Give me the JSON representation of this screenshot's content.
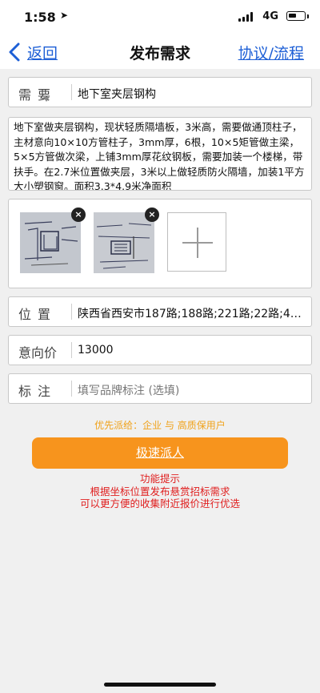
{
  "status": {
    "time": "1:58",
    "network": "4G"
  },
  "nav": {
    "back_label": "返回",
    "title": "发布需求",
    "right_label": "协议/流程"
  },
  "form": {
    "need_label": "需要",
    "need_value": "地下室夹层钢构",
    "description": "地下室做夹层钢构，现状轻质隔墙板，3米高，需要做通顶柱子，主材意向10×10方管柱子，3mm厚，6根，10×5矩管做主梁，5×5方管做次梁，上铺3mm厚花纹钢板，需要加装一个楼梯，带扶手。在2.7米位置做夹层，3米以上做轻质防火隔墙，加装1平方大小塑钢窗。面积3.3*4.9米净面积",
    "photos": [
      {
        "delete": "×"
      },
      {
        "delete": "×"
      }
    ],
    "location_label": "位置",
    "location_value": "陕西省西安市187路;188路;221路;22路;40...",
    "price_label": "意向价",
    "price_value": "13000",
    "note_label": "标注",
    "note_placeholder": "填写品牌标注 (选填)"
  },
  "priority_text": "优先派给：企业 与 高质保用户",
  "submit_label": "极速派人",
  "tips": {
    "title": "功能提示",
    "line1": "根据坐标位置发布悬赏招标需求",
    "line2": "可以更方便的收集附近报价进行优选"
  },
  "colors": {
    "link": "#1d5fd6",
    "accent": "#f7941d",
    "warning": "#e02020",
    "priority": "#f0a21a"
  }
}
